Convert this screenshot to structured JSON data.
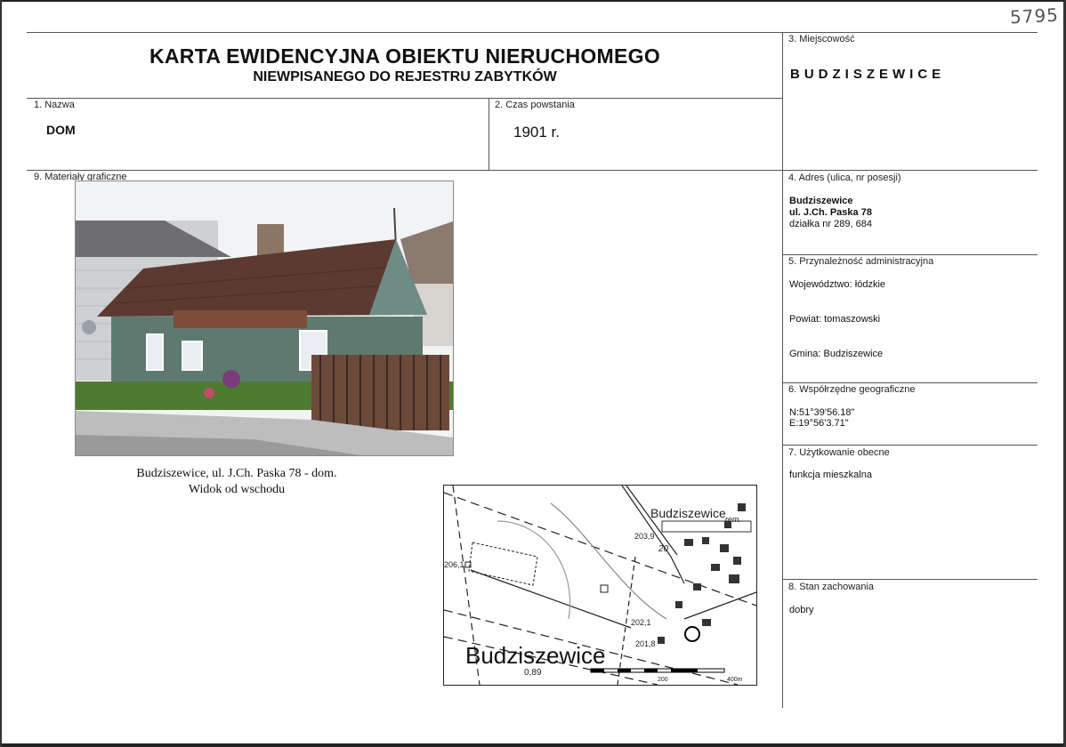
{
  "stamp": "5795",
  "header": {
    "title": "KARTA EWIDENCYJNA OBIEKTU NIERUCHOMEGO",
    "subtitle": "NIEWPISANEGO DO REJESTRU ZABYTKÓW"
  },
  "fields": {
    "nazwa": {
      "label": "1. Nazwa",
      "value": "DOM"
    },
    "czas": {
      "label": "2. Czas powstania",
      "value": "1901 r."
    },
    "miejscowosc": {
      "label": "3. Miejscowość",
      "value": "BUDZISZEWICE"
    },
    "adres": {
      "label": "4. Adres (ulica, nr posesji)",
      "line1": "Budziszewice",
      "line2": "ul. J.Ch. Paska 78",
      "line3": "działka nr 289, 684"
    },
    "przynaleznosc": {
      "label": "5. Przynależność administracyjna",
      "wojewodztwo": "Województwo: łódzkie",
      "powiat": "Powiat: tomaszowski",
      "gmina": "Gmina: Budziszewice"
    },
    "wspolrzedne": {
      "label": "6. Współrzędne geograficzne",
      "n": "N:51°39'56.18\"",
      "e": "E:19°56'3.71\""
    },
    "uzytkowanie": {
      "label": "7. Użytkowanie obecne",
      "value": "funkcja mieszkalna"
    },
    "stan": {
      "label": "8. Stan zachowania",
      "value": "dobry"
    },
    "materialy": {
      "label": "9. Materiały graficzne"
    }
  },
  "photo_caption": {
    "line1": "Budziszewice, ul. J.Ch. Paska 78 - dom.",
    "line2": "Widok od wschodu"
  },
  "map": {
    "place_large": "Budziszewice",
    "place_small": "Budziszewice",
    "rem": "rem.",
    "elev1": "203,9",
    "elev2": "206,1",
    "elev3": "202,1",
    "elev4": "201,8",
    "elev5": "0,89",
    "num20": "20",
    "scale_end": "400m",
    "scale_mid": "200"
  }
}
